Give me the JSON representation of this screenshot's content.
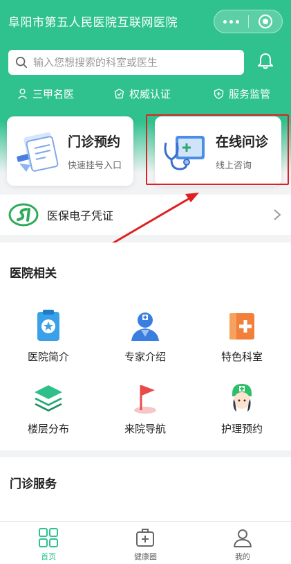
{
  "header": {
    "title": "阜阳市第五人民医院互联网医院"
  },
  "search": {
    "placeholder": "输入您想搜索的科室或医生"
  },
  "badges": [
    "三甲名医",
    "权威认证",
    "服务监管"
  ],
  "cards": [
    {
      "title": "门诊预约",
      "subtitle": "快速挂号入口"
    },
    {
      "title": "在线问诊",
      "subtitle": "线上咨询"
    }
  ],
  "insurance": {
    "label": "医保电子凭证"
  },
  "hospital_section": {
    "title": "医院相关",
    "items": [
      "医院简介",
      "专家介绍",
      "特色科室",
      "楼层分布",
      "来院导航",
      "护理预约"
    ]
  },
  "outpatient_section": {
    "title": "门诊服务"
  },
  "tabbar": {
    "items": [
      "首页",
      "健康圈",
      "我的"
    ]
  },
  "colors": {
    "brand": "#2fc28f",
    "highlight": "#e02020"
  }
}
